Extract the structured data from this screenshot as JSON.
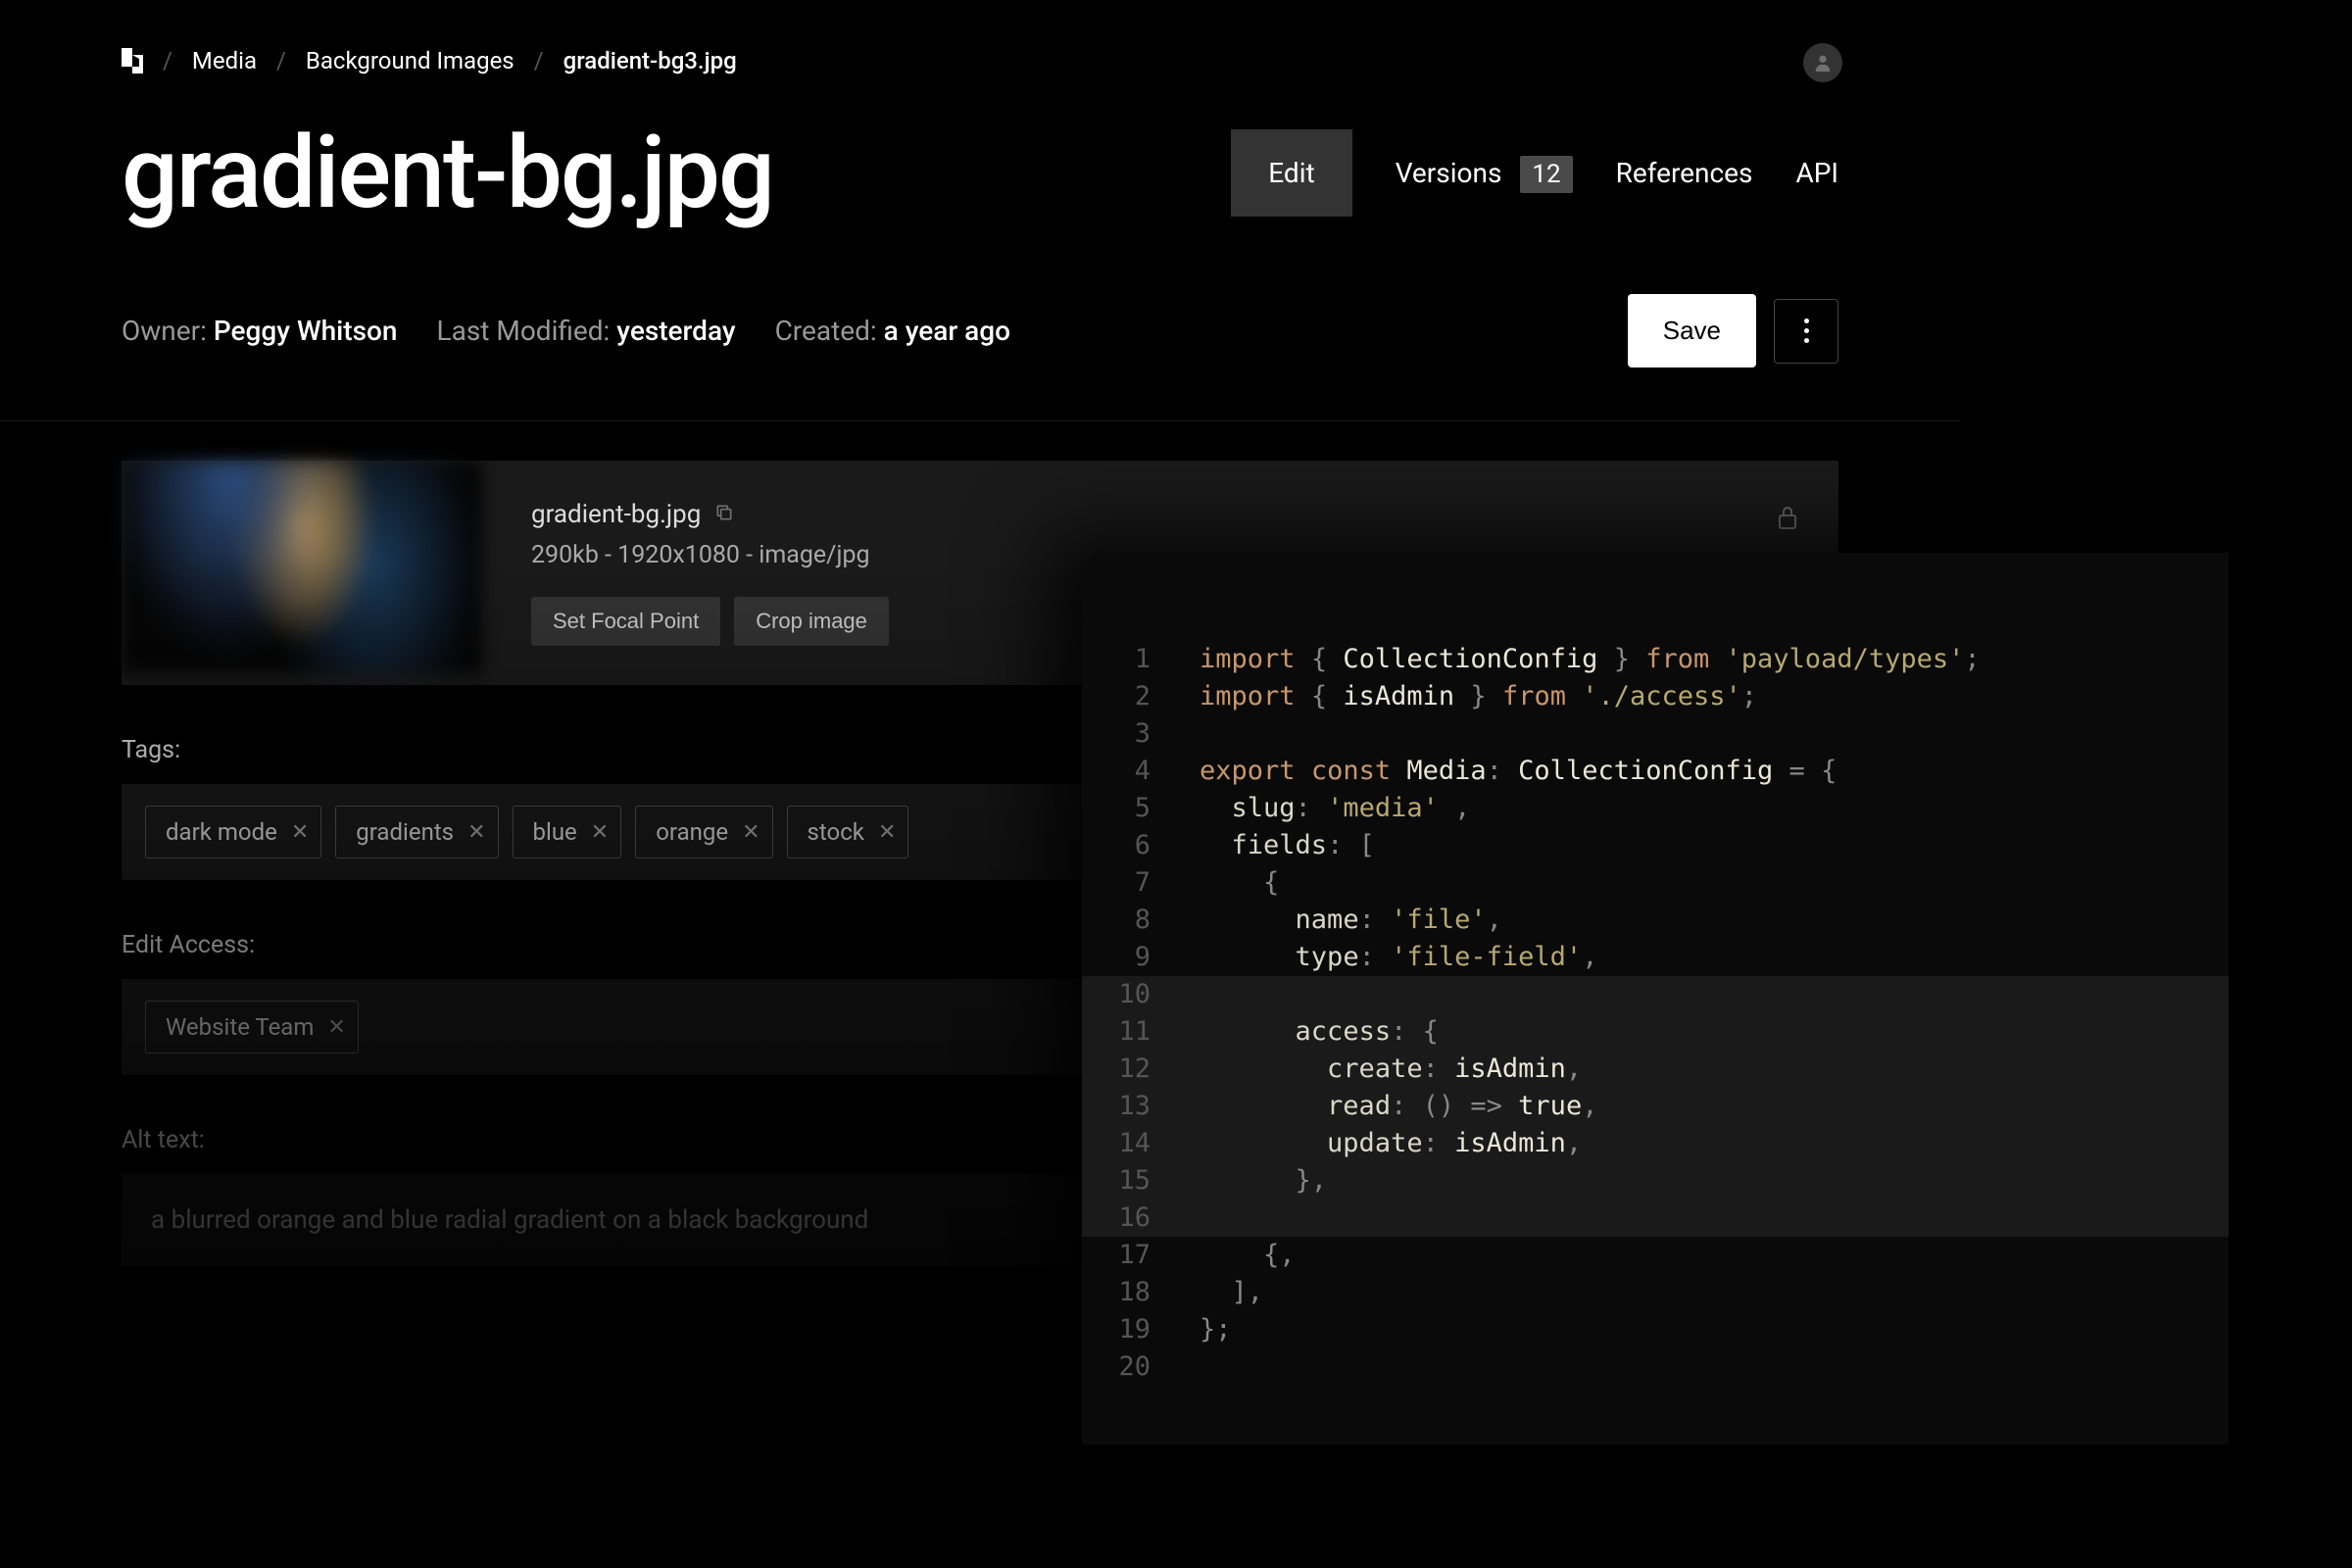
{
  "breadcrumb": {
    "items": [
      "Media",
      "Background Images",
      "gradient-bg3.jpg"
    ]
  },
  "page_title": "gradient-bg.jpg",
  "tabs": {
    "edit": "Edit",
    "versions": "Versions",
    "versions_count": "12",
    "references": "References",
    "api": "API"
  },
  "meta": {
    "owner_label": "Owner: ",
    "owner_value": "Peggy Whitson",
    "modified_label": "Last Modified: ",
    "modified_value": "yesterday",
    "created_label": "Created: ",
    "created_value": "a year ago"
  },
  "actions": {
    "save": "Save"
  },
  "file": {
    "name": "gradient-bg.jpg",
    "meta": "290kb - 1920x1080 - image/jpg",
    "set_focal": "Set Focal Point",
    "crop": "Crop image"
  },
  "fields": {
    "tags_label": "Tags:",
    "tags": [
      "dark mode",
      "gradients",
      "blue",
      "orange",
      "stock"
    ],
    "access_label": "Edit Access:",
    "access": [
      "Website Team"
    ],
    "alt_label": "Alt text:",
    "alt_value": "a blurred orange and blue radial gradient on a black background"
  },
  "code": {
    "lines": [
      {
        "n": "1",
        "tokens": [
          [
            "kw",
            "import"
          ],
          [
            "",
            " "
          ],
          [
            "punc",
            "{"
          ],
          [
            "",
            " "
          ],
          [
            "id",
            "CollectionConfig"
          ],
          [
            "",
            " "
          ],
          [
            "punc",
            "}"
          ],
          [
            "",
            " "
          ],
          [
            "kw",
            "from"
          ],
          [
            "",
            " "
          ],
          [
            "str",
            "'payload/types'"
          ],
          [
            "punc",
            ";"
          ]
        ]
      },
      {
        "n": "2",
        "tokens": [
          [
            "kw",
            "import"
          ],
          [
            "",
            " "
          ],
          [
            "punc",
            "{"
          ],
          [
            "",
            " "
          ],
          [
            "id",
            "isAdmin"
          ],
          [
            "",
            " "
          ],
          [
            "punc",
            "}"
          ],
          [
            "",
            " "
          ],
          [
            "kw",
            "from"
          ],
          [
            "",
            " "
          ],
          [
            "str",
            "'./access'"
          ],
          [
            "punc",
            ";"
          ]
        ]
      },
      {
        "n": "3",
        "tokens": []
      },
      {
        "n": "4",
        "tokens": [
          [
            "kw",
            "export"
          ],
          [
            "",
            " "
          ],
          [
            "kw",
            "const"
          ],
          [
            "",
            " "
          ],
          [
            "id",
            "Media"
          ],
          [
            "punc",
            ":"
          ],
          [
            "",
            " "
          ],
          [
            "type",
            "CollectionConfig"
          ],
          [
            "",
            " "
          ],
          [
            "punc",
            "="
          ],
          [
            "",
            " "
          ],
          [
            "punc",
            "{"
          ]
        ]
      },
      {
        "n": "5",
        "tokens": [
          [
            "",
            "  "
          ],
          [
            "prop",
            "slug"
          ],
          [
            "punc",
            ":"
          ],
          [
            "",
            " "
          ],
          [
            "str",
            "'media'"
          ],
          [
            "",
            " "
          ],
          [
            "punc",
            ","
          ]
        ]
      },
      {
        "n": "6",
        "tokens": [
          [
            "",
            "  "
          ],
          [
            "prop",
            "fields"
          ],
          [
            "punc",
            ":"
          ],
          [
            "",
            " "
          ],
          [
            "punc",
            "["
          ]
        ]
      },
      {
        "n": "7",
        "tokens": [
          [
            "",
            "    "
          ],
          [
            "punc",
            "{"
          ]
        ]
      },
      {
        "n": "8",
        "tokens": [
          [
            "",
            "      "
          ],
          [
            "prop",
            "name"
          ],
          [
            "punc",
            ":"
          ],
          [
            "",
            " "
          ],
          [
            "str",
            "'file'"
          ],
          [
            "punc",
            ","
          ]
        ]
      },
      {
        "n": "9",
        "tokens": [
          [
            "",
            "      "
          ],
          [
            "prop",
            "type"
          ],
          [
            "punc",
            ":"
          ],
          [
            "",
            " "
          ],
          [
            "str",
            "'file-field'"
          ],
          [
            "punc",
            ","
          ]
        ]
      },
      {
        "n": "10",
        "hl": true,
        "tokens": []
      },
      {
        "n": "11",
        "hl": true,
        "tokens": [
          [
            "",
            "      "
          ],
          [
            "prop",
            "access"
          ],
          [
            "punc",
            ":"
          ],
          [
            "",
            " "
          ],
          [
            "punc",
            "{"
          ]
        ]
      },
      {
        "n": "12",
        "hl": true,
        "tokens": [
          [
            "",
            "        "
          ],
          [
            "prop",
            "create"
          ],
          [
            "punc",
            ":"
          ],
          [
            "",
            " "
          ],
          [
            "id",
            "isAdmin"
          ],
          [
            "punc",
            ","
          ]
        ]
      },
      {
        "n": "13",
        "hl": true,
        "tokens": [
          [
            "",
            "        "
          ],
          [
            "prop",
            "read"
          ],
          [
            "punc",
            ":"
          ],
          [
            "",
            " "
          ],
          [
            "punc",
            "()"
          ],
          [
            "",
            " "
          ],
          [
            "punc",
            "=>"
          ],
          [
            "",
            " "
          ],
          [
            "bool",
            "true"
          ],
          [
            "punc",
            ","
          ]
        ]
      },
      {
        "n": "14",
        "hl": true,
        "tokens": [
          [
            "",
            "        "
          ],
          [
            "prop",
            "update"
          ],
          [
            "punc",
            ":"
          ],
          [
            "",
            " "
          ],
          [
            "id",
            "isAdmin"
          ],
          [
            "punc",
            ","
          ]
        ]
      },
      {
        "n": "15",
        "hl": true,
        "tokens": [
          [
            "",
            "      "
          ],
          [
            "punc",
            "},"
          ]
        ]
      },
      {
        "n": "16",
        "hl": true,
        "tokens": []
      },
      {
        "n": "17",
        "tokens": [
          [
            "",
            "    "
          ],
          [
            "punc",
            "{,"
          ]
        ]
      },
      {
        "n": "18",
        "tokens": [
          [
            "",
            "  "
          ],
          [
            "punc",
            "],"
          ]
        ]
      },
      {
        "n": "19",
        "tokens": [
          [
            "punc",
            "};"
          ]
        ]
      },
      {
        "n": "20",
        "tokens": []
      }
    ]
  }
}
